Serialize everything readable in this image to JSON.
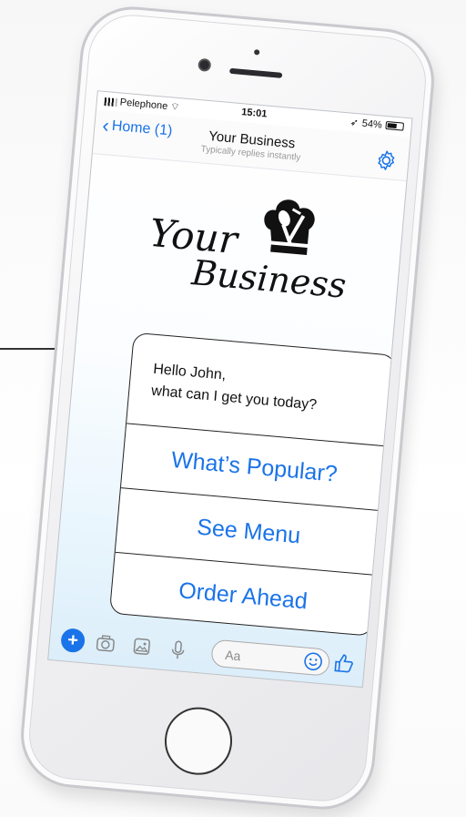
{
  "status_bar": {
    "carrier": "Pelephone",
    "time": "15:01",
    "battery": "54%"
  },
  "nav": {
    "back_label": "Home (1)",
    "title": "Your Business",
    "subtitle": "Typically replies instantly"
  },
  "logo": {
    "line1": "Your",
    "line2": "Business"
  },
  "chat": {
    "greeting_line1": "Hello John,",
    "greeting_line2": "what can I get you today?",
    "options": [
      {
        "label": "What’s Popular?"
      },
      {
        "label": "See Menu"
      },
      {
        "label": "Order Ahead"
      }
    ]
  },
  "composer": {
    "placeholder": "Aa",
    "icons": [
      "plus-icon",
      "camera-icon",
      "photo-icon",
      "microphone-icon",
      "emoji-icon",
      "thumbs-up-icon"
    ]
  },
  "colors": {
    "accent": "#1a73e8",
    "text": "#111111"
  }
}
